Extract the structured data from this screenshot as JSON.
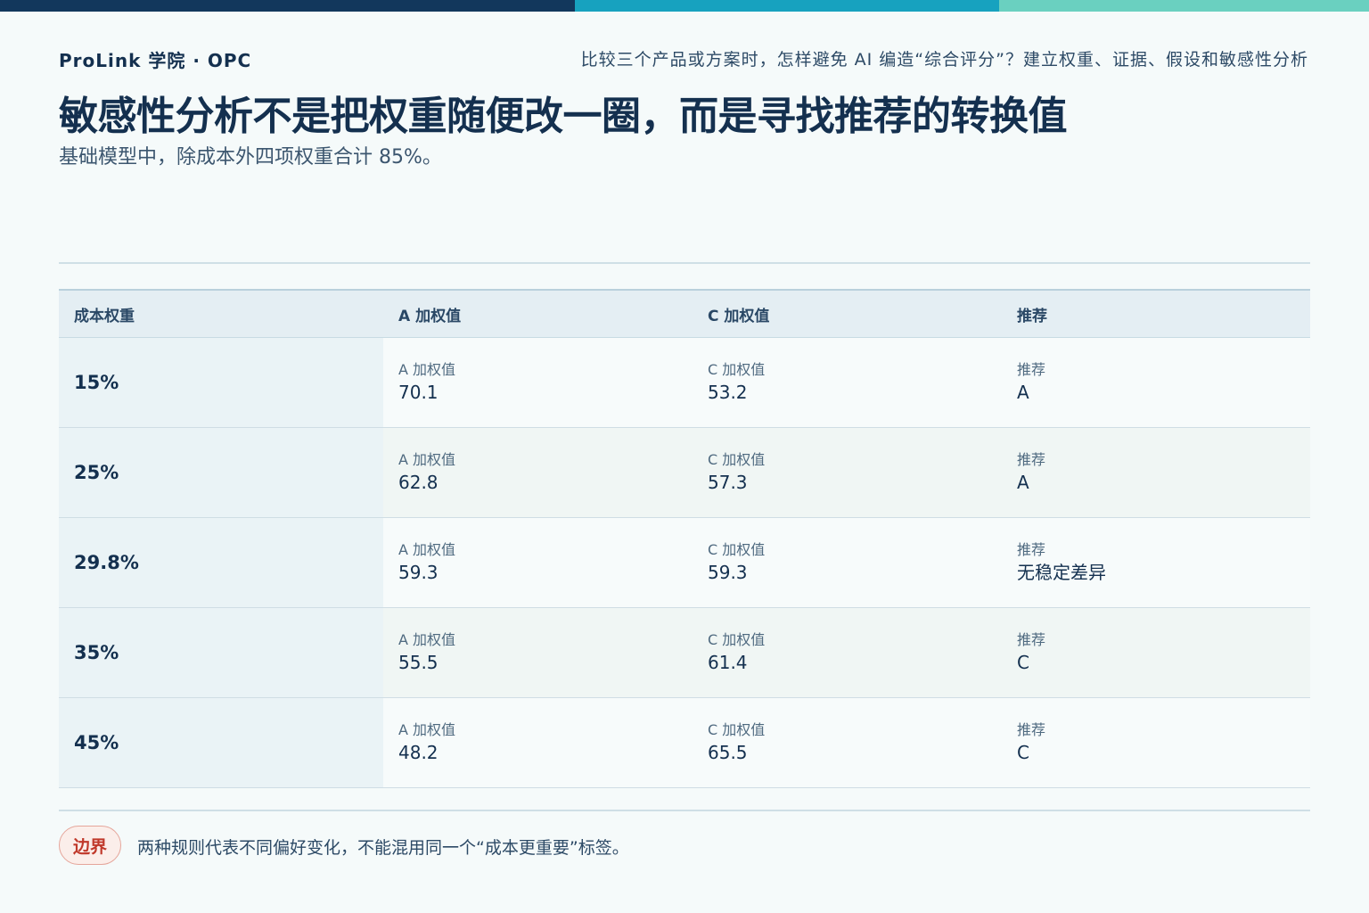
{
  "header": {
    "brand": "ProLink 学院 · OPC",
    "topic": "比较三个产品或方案时，怎样避免 AI 编造“综合评分”？建立权重、证据、假设和敏感性分析",
    "title": "敏感性分析不是把权重随便改一圈，而是寻找推荐的转换值",
    "subtitle": "基础模型中，除成本外四项权重合计 85%。"
  },
  "colors": {
    "bar_dark": "#12375c",
    "bar_mid": "#17a2bf",
    "bar_light": "#6ad0c0",
    "badge_red": "#c0392b"
  },
  "table": {
    "headers": [
      "成本权重",
      "A 加权值",
      "C 加权值",
      "推荐"
    ],
    "rows": [
      {
        "cost_weight": "15%",
        "a_label": "A 加权值",
        "a_value": "70.1",
        "c_label": "C 加权值",
        "c_value": "53.2",
        "rec_label": "推荐",
        "rec_value": "A"
      },
      {
        "cost_weight": "25%",
        "a_label": "A 加权值",
        "a_value": "62.8",
        "c_label": "C 加权值",
        "c_value": "57.3",
        "rec_label": "推荐",
        "rec_value": "A"
      },
      {
        "cost_weight": "29.8%",
        "a_label": "A 加权值",
        "a_value": "59.3",
        "c_label": "C 加权值",
        "c_value": "59.3",
        "rec_label": "推荐",
        "rec_value": "无稳定差异"
      },
      {
        "cost_weight": "35%",
        "a_label": "A 加权值",
        "a_value": "55.5",
        "c_label": "C 加权值",
        "c_value": "61.4",
        "rec_label": "推荐",
        "rec_value": "C"
      },
      {
        "cost_weight": "45%",
        "a_label": "A 加权值",
        "a_value": "48.2",
        "c_label": "C 加权值",
        "c_value": "65.5",
        "rec_label": "推荐",
        "rec_value": "C"
      }
    ]
  },
  "footer": {
    "badge": "边界",
    "note": "两种规则代表不同偏好变化，不能混用同一个“成本更重要”标签。"
  }
}
